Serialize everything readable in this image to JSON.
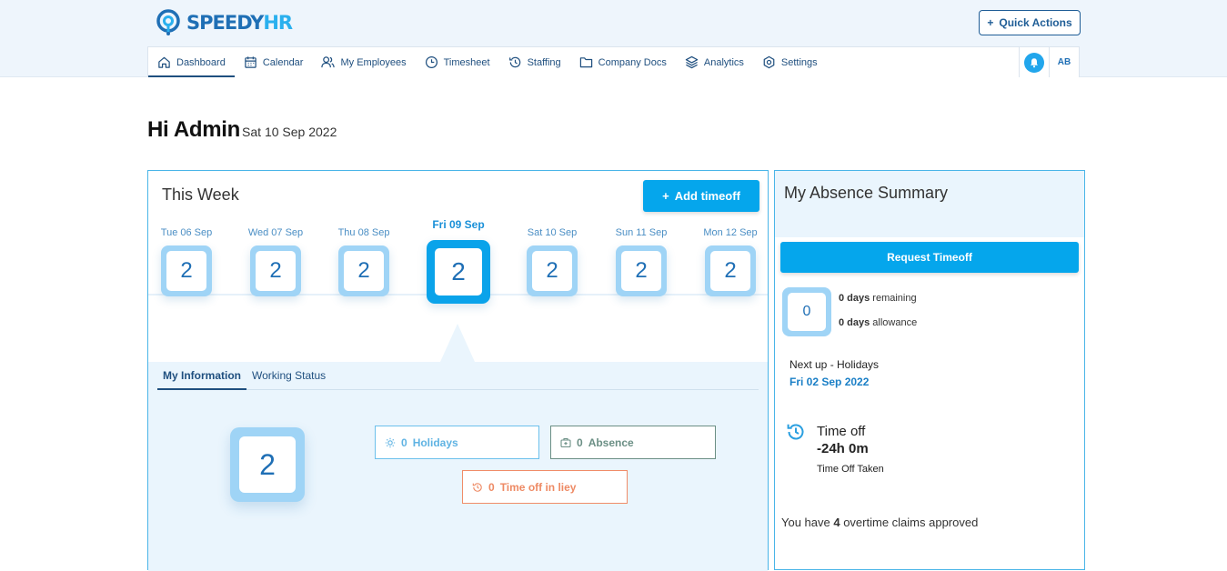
{
  "brand": {
    "logo_part1": "SPEEDY",
    "logo_part2": "HR"
  },
  "header": {
    "quick_actions_label": "Quick Actions"
  },
  "nav": {
    "items": [
      {
        "label": "Dashboard",
        "icon": "home-icon"
      },
      {
        "label": "Calendar",
        "icon": "calendar-icon"
      },
      {
        "label": "My Employees",
        "icon": "users-icon"
      },
      {
        "label": "Timesheet",
        "icon": "clock-icon"
      },
      {
        "label": "Staffing",
        "icon": "history-icon"
      },
      {
        "label": "Company Docs",
        "icon": "folder-icon"
      },
      {
        "label": "Analytics",
        "icon": "layers-icon"
      },
      {
        "label": "Settings",
        "icon": "gear-icon"
      }
    ],
    "avatar_initials": "AB"
  },
  "greeting": {
    "title": "Hi Admin",
    "date": "Sat 10 Sep 2022"
  },
  "week": {
    "title": "This Week",
    "add_timeoff_label": "Add timeoff",
    "days": [
      {
        "label": "Tue 06 Sep",
        "count": "2"
      },
      {
        "label": "Wed 07 Sep",
        "count": "2"
      },
      {
        "label": "Thu 08 Sep",
        "count": "2"
      },
      {
        "label": "Fri 09 Sep",
        "count": "2"
      },
      {
        "label": "Sat 10 Sep",
        "count": "2"
      },
      {
        "label": "Sun 11 Sep",
        "count": "2"
      },
      {
        "label": "Mon 12 Sep",
        "count": "2"
      }
    ],
    "tabs": [
      "My Information",
      "Working Status"
    ],
    "info_count": "2",
    "holidays": {
      "count": "0",
      "label": "Holidays"
    },
    "absence": {
      "count": "0",
      "label": "Absence"
    },
    "toil": {
      "count": "0",
      "label": "Time off in liey"
    }
  },
  "summary": {
    "title": "My Absence Summary",
    "request_label": "Request Timeoff",
    "days_box": "0",
    "remaining_bold": "0 days",
    "remaining_text": " remaining",
    "allowance_bold": "0 days",
    "allowance_text": " allowance",
    "next_up_label": "Next up - Holidays",
    "next_up_date": "Fri 02 Sep 2022",
    "timeoff_label": "Time off",
    "timeoff_value": "-24h 0m",
    "timeoff_taken_label": "Time Off Taken",
    "overtime_prefix": "You have ",
    "overtime_count": "4",
    "overtime_suffix": " overtime claims approved"
  }
}
